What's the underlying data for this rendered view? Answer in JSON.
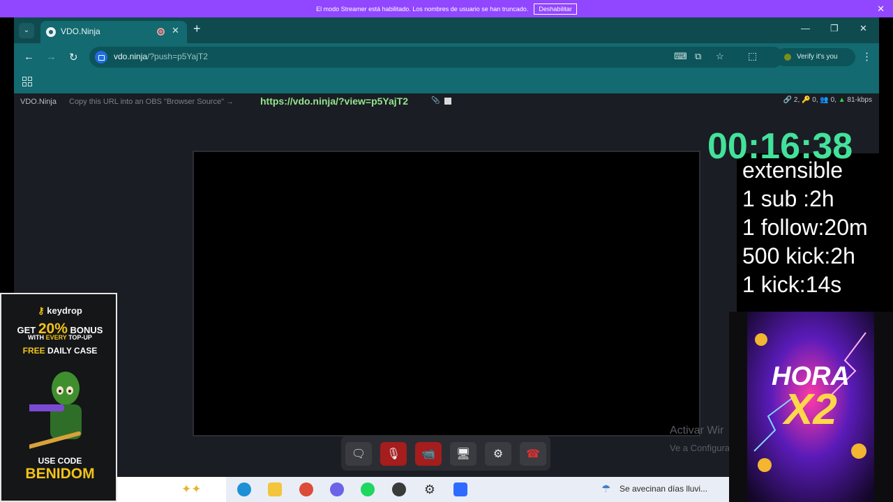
{
  "banner": {
    "message": "El modo Streamer está habilitado. Los nombres de usuario se han truncado.",
    "button_label": "Deshabilitar",
    "close_glyph": "✕"
  },
  "browser": {
    "tab_title": "VDO.Ninja",
    "url_host": "vdo.ninja",
    "url_path": "/?push=p5YajT2",
    "verify_label": "Verify it's you"
  },
  "page": {
    "brand": "VDO.Ninja",
    "copy_hint": "Copy this URL into an OBS \"Browser Source\" →",
    "view_link": "https://vdo.ninja/?view=p5YajT2",
    "stats": {
      "links": "2",
      "keys": "0",
      "viewers": "0",
      "bitrate": "81-kbps"
    },
    "watermark_line1": "Activar Wir",
    "watermark_line2": "Ve a Configura"
  },
  "controls": [
    {
      "name": "chat-button",
      "icon": "chat-icon",
      "glyph": "🗨",
      "state": "normal"
    },
    {
      "name": "mute-mic-button",
      "icon": "mic-off-icon",
      "glyph": "🎙",
      "state": "active-red"
    },
    {
      "name": "camera-off-button",
      "icon": "camera-off-icon",
      "glyph": "📹",
      "state": "active-red"
    },
    {
      "name": "screenshare-button",
      "icon": "monitor-icon",
      "glyph": "🖥",
      "state": "normal"
    },
    {
      "name": "settings-button",
      "icon": "gear-icon",
      "glyph": "⚙",
      "state": "normal"
    },
    {
      "name": "hangup-button",
      "icon": "phone-hangup-icon",
      "glyph": "☎",
      "state": "normal"
    }
  ],
  "overlay": {
    "timer": "00:16:38",
    "lines": [
      "extensible",
      "1 sub :2h",
      "1 follow:20m",
      "500 kick:2h",
      "1 kick:14s"
    ]
  },
  "ad_left": {
    "logo_key": "key",
    "logo_drop": "drop",
    "get": "GET",
    "percent": "20%",
    "bonus": "BONUS",
    "with": "WITH",
    "every": "EVERY",
    "topup": "TOP-UP",
    "free": "FREE",
    "daily": "DAILY CASE",
    "use_code": "USE CODE",
    "code": "BENIDOM"
  },
  "ad_right": {
    "line1": "HORA",
    "line2": "X2"
  },
  "taskbar": {
    "weather_text": "Se avecinan días lluvi..."
  },
  "colors": {
    "banner": "#9146ff",
    "tab_teal": "#136a70",
    "link_green": "#93e68d",
    "timer_green": "#43e29b",
    "ad_yellow": "#f2c318"
  }
}
